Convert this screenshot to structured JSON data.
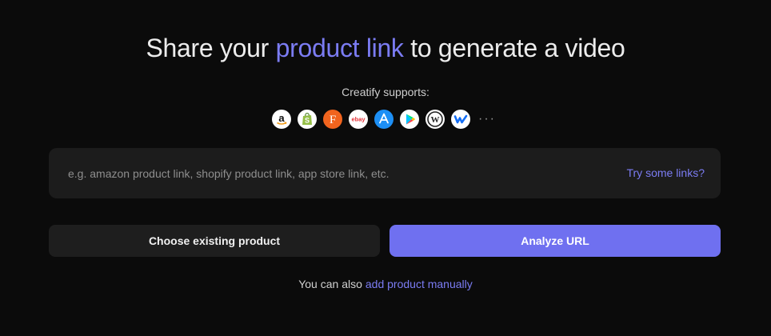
{
  "headline": {
    "prefix": "Share your ",
    "accent": "product link",
    "suffix": " to generate a video"
  },
  "supports": {
    "label": "Creatify supports:",
    "platforms": [
      {
        "icon": "amazon-icon",
        "letter": "a"
      },
      {
        "icon": "shopify-icon",
        "letter": "S"
      },
      {
        "icon": "etsy-icon",
        "letter": "F"
      },
      {
        "icon": "ebay-icon",
        "letter": "ebay"
      },
      {
        "icon": "app-store-icon",
        "letter": "A"
      },
      {
        "icon": "google-play-icon",
        "letter": ""
      },
      {
        "icon": "wordpress-icon",
        "letter": "W"
      },
      {
        "icon": "webflow-icon",
        "letter": "w"
      }
    ],
    "more": "···"
  },
  "url_input": {
    "placeholder": "e.g. amazon product link, shopify product link, app store link, etc.",
    "value": "",
    "try_links_label": "Try some links?"
  },
  "actions": {
    "choose_existing_label": "Choose existing product",
    "analyze_label": "Analyze URL"
  },
  "footer": {
    "text": "You can also",
    "link": "add product manually"
  },
  "colors": {
    "background": "#0b0b0b",
    "accent": "#7b7cf3",
    "primary_button": "#6f70f0",
    "panel": "#1c1c1c"
  }
}
